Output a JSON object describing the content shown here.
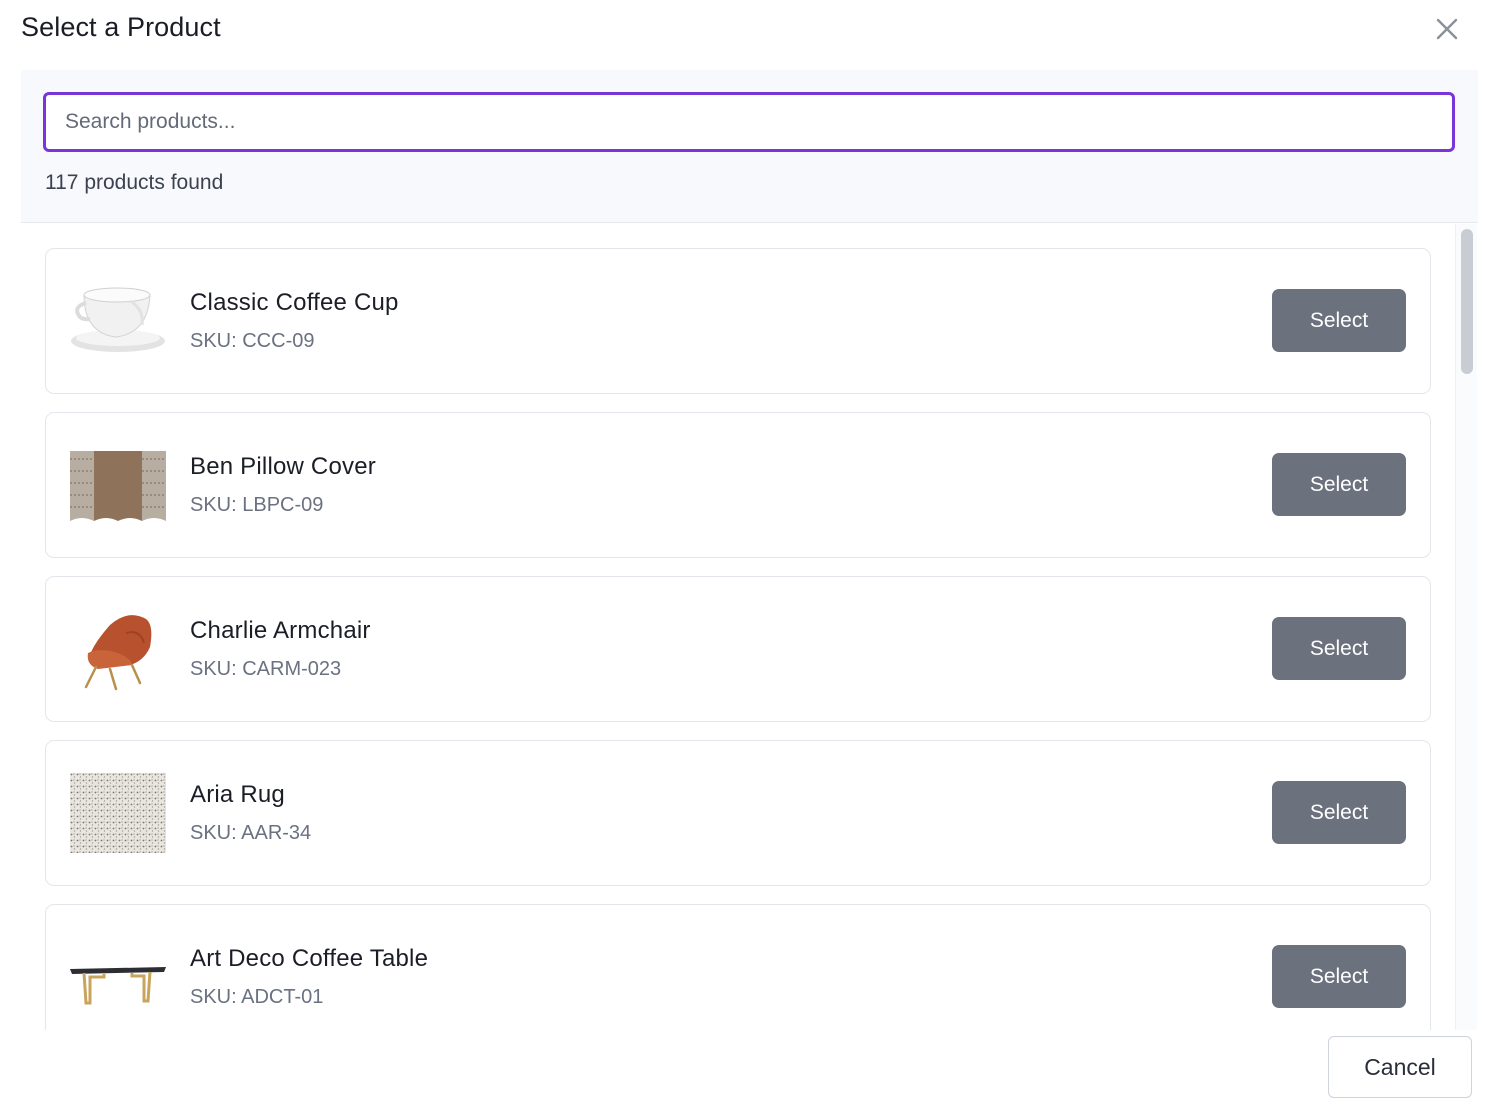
{
  "modal": {
    "title": "Select a Product",
    "close_icon": "close-icon"
  },
  "search": {
    "placeholder": "Search products...",
    "value": "",
    "result_count": "117 products found"
  },
  "products": [
    {
      "name": "Classic Coffee Cup",
      "sku": "SKU: CCC-09",
      "image": "coffee-cup-image",
      "select_label": "Select"
    },
    {
      "name": "Ben Pillow Cover",
      "sku": "SKU: LBPC-09",
      "image": "pillow-cover-image",
      "select_label": "Select"
    },
    {
      "name": "Charlie Armchair",
      "sku": "SKU: CARM-023",
      "image": "armchair-image",
      "select_label": "Select"
    },
    {
      "name": "Aria Rug",
      "sku": "SKU: AAR-34",
      "image": "rug-image",
      "select_label": "Select"
    },
    {
      "name": "Art Deco Coffee Table",
      "sku": "SKU: ADCT-01",
      "image": "coffee-table-image",
      "select_label": "Select"
    }
  ],
  "footer": {
    "cancel_label": "Cancel"
  },
  "colors": {
    "accent": "#7a35d8",
    "select_button": "#6c717e",
    "panel_bg": "#f7f9fc"
  }
}
